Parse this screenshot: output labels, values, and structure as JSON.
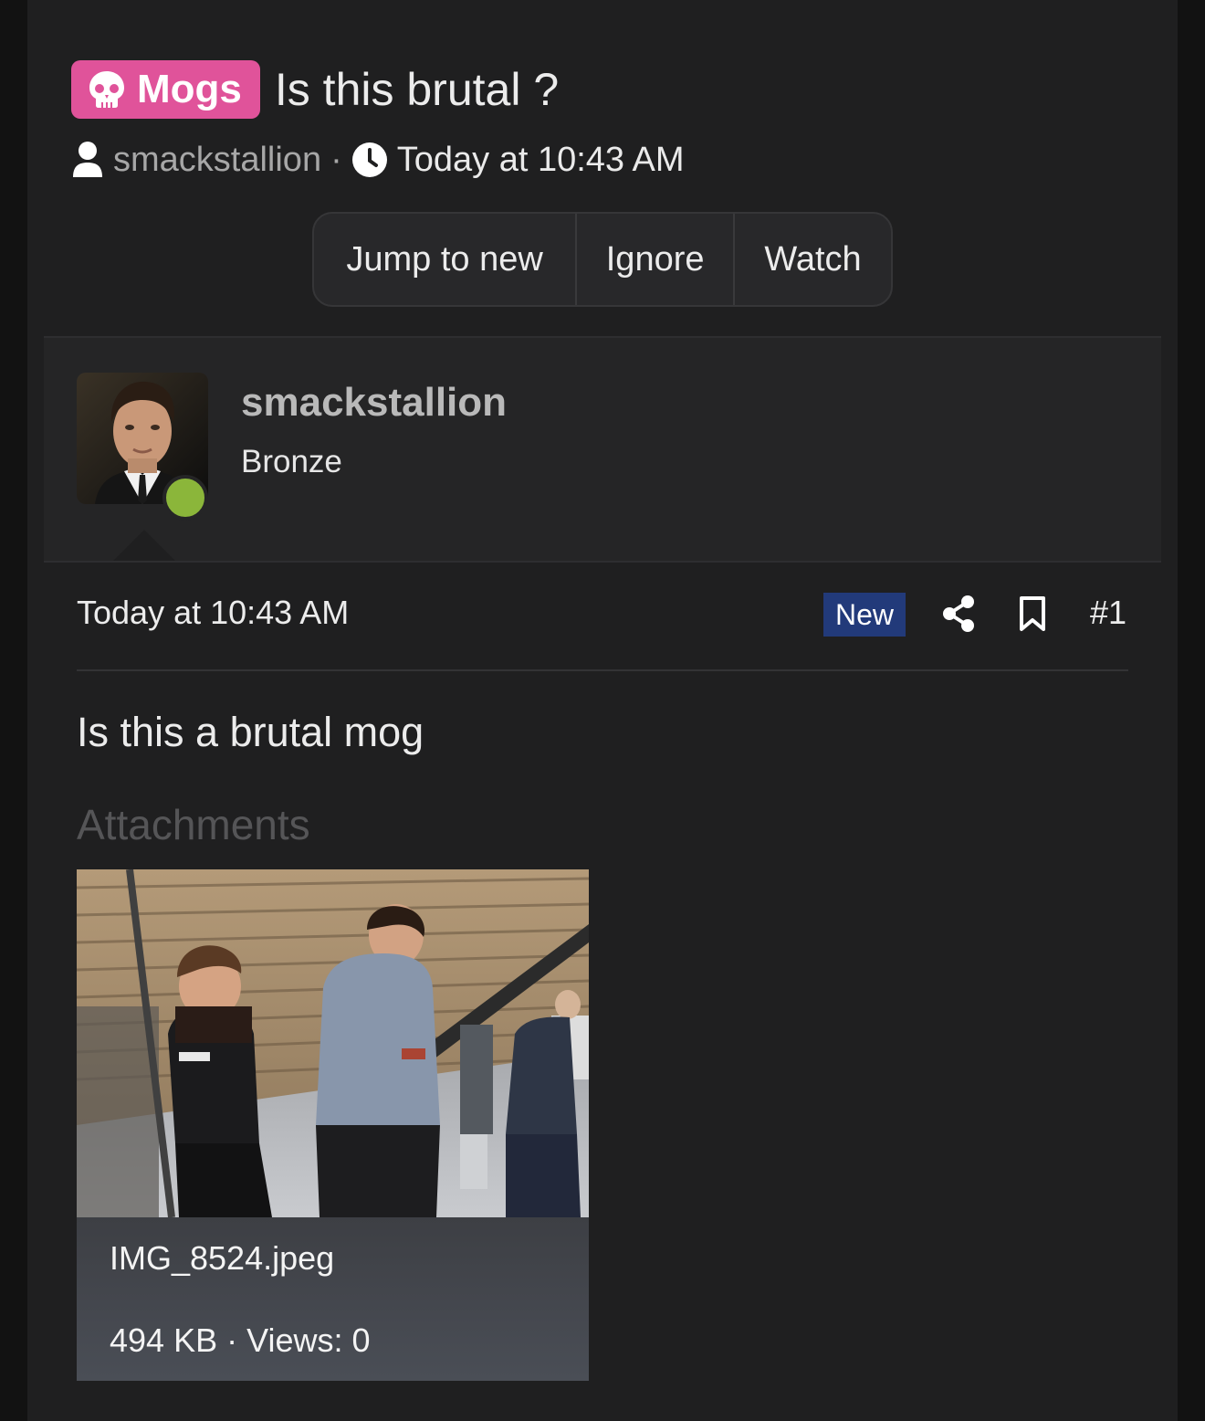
{
  "thread": {
    "prefix": "Mogs",
    "title": "Is this brutal ?",
    "author": "smackstallion",
    "separator": "·",
    "time": "Today at 10:43 AM"
  },
  "actions": {
    "jump_to_new": "Jump to new",
    "ignore": "Ignore",
    "watch": "Watch"
  },
  "post": {
    "user_name": "smackstallion",
    "user_title": "Bronze",
    "time": "Today at 10:43 AM",
    "new_badge": "New",
    "number": "#1",
    "body": "Is this a brutal mog",
    "attachments_label": "Attachments",
    "attachment": {
      "file_name": "IMG_8524.jpeg",
      "meta": "494 KB · Views: 0"
    }
  },
  "colors": {
    "prefix_bg": "#e0539a",
    "new_badge_bg": "#223a7a",
    "online": "#8bb63a"
  },
  "icons": [
    "skull-icon",
    "user-icon",
    "clock-icon",
    "share-icon",
    "bookmark-icon"
  ]
}
